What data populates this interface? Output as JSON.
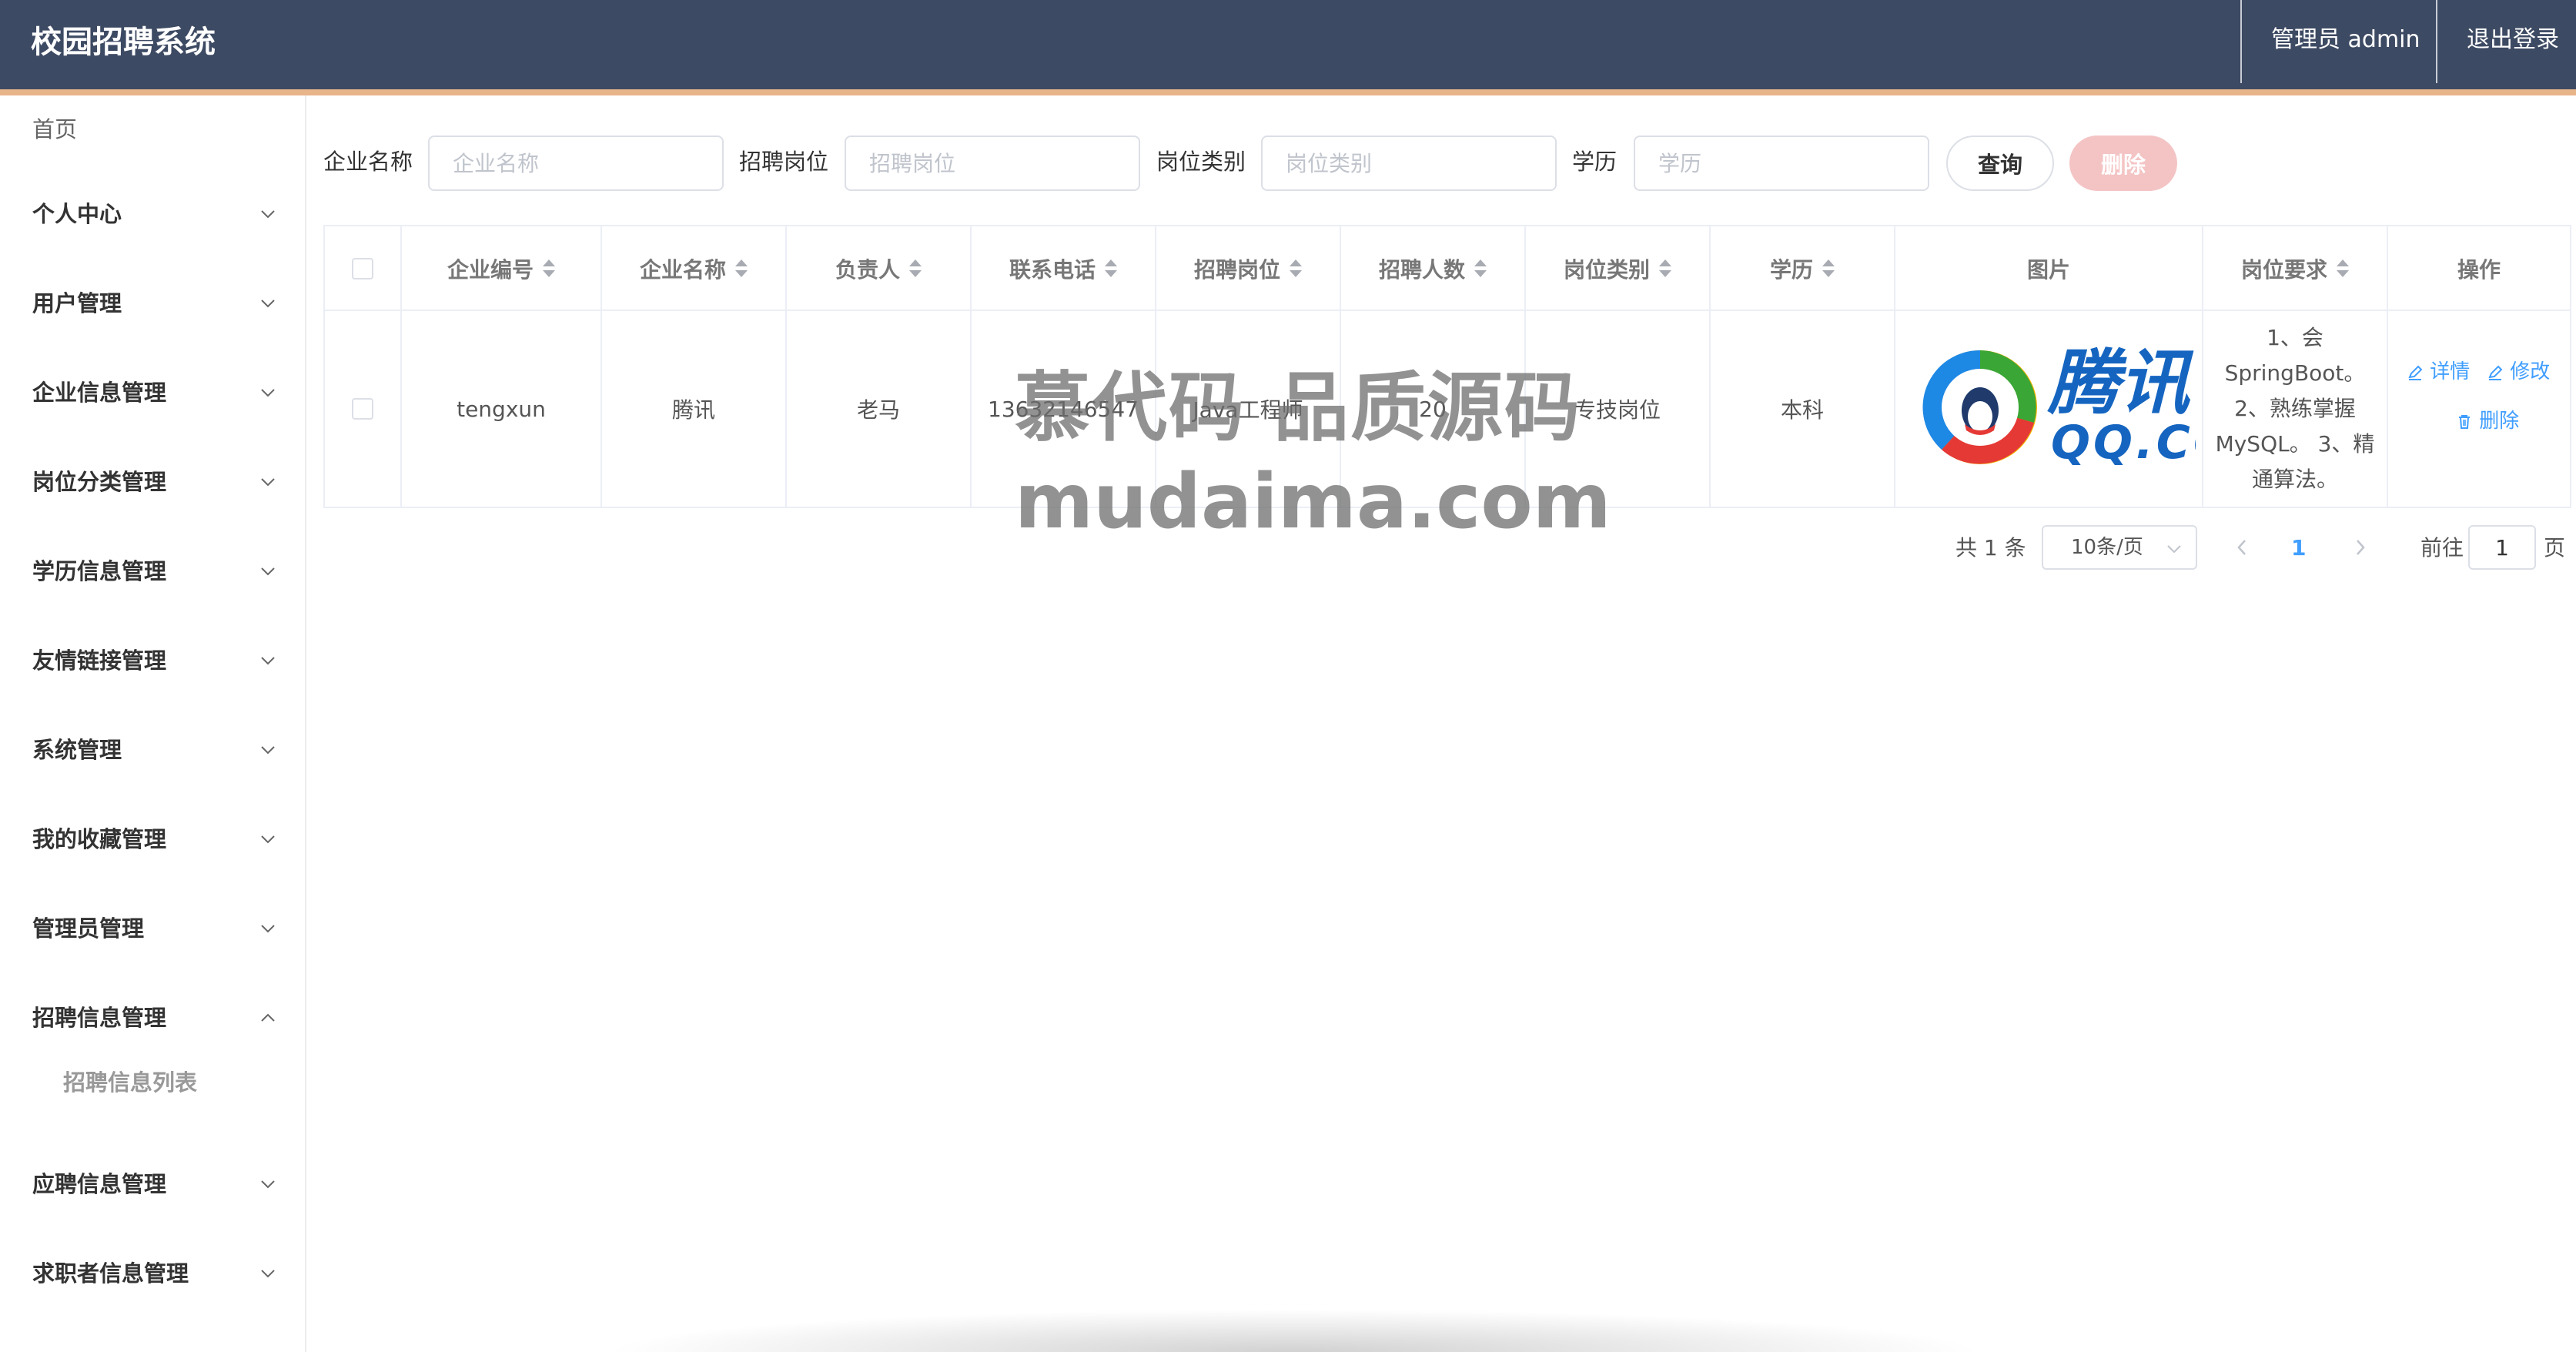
{
  "header": {
    "title": "校园招聘系统",
    "user": "管理员 admin",
    "logout": "退出登录"
  },
  "sidebar": {
    "home": "首页",
    "items": [
      {
        "label": "个人中心",
        "expanded": false
      },
      {
        "label": "用户管理",
        "expanded": false
      },
      {
        "label": "企业信息管理",
        "expanded": false
      },
      {
        "label": "岗位分类管理",
        "expanded": false
      },
      {
        "label": "学历信息管理",
        "expanded": false
      },
      {
        "label": "友情链接管理",
        "expanded": false
      },
      {
        "label": "系统管理",
        "expanded": false
      },
      {
        "label": "我的收藏管理",
        "expanded": false
      },
      {
        "label": "管理员管理",
        "expanded": false
      },
      {
        "label": "招聘信息管理",
        "expanded": true
      },
      {
        "label": "应聘信息管理",
        "expanded": false
      },
      {
        "label": "求职者信息管理",
        "expanded": false
      }
    ],
    "subitem": "招聘信息列表"
  },
  "search": {
    "company_label": "企业名称",
    "company_placeholder": "企业名称",
    "position_label": "招聘岗位",
    "position_placeholder": "招聘岗位",
    "category_label": "岗位类别",
    "category_placeholder": "岗位类别",
    "education_label": "学历",
    "education_placeholder": "学历",
    "query_button": "查询",
    "delete_button": "删除"
  },
  "table": {
    "headers": [
      "企业编号",
      "企业名称",
      "负责人",
      "联系电话",
      "招聘岗位",
      "招聘人数",
      "岗位类别",
      "学历",
      "图片",
      "岗位要求",
      "操作"
    ],
    "rows": [
      {
        "company_id": "tengxun",
        "company_name": "腾讯",
        "manager": "老马",
        "phone": "13632146547",
        "position": "Java工程师",
        "count": "20",
        "category": "专技岗位",
        "education": "本科",
        "image_text": "腾讯",
        "image_subtext": "QQ.CO",
        "requirement": "1、会SpringBoot。 2、熟练掌握MySQL。 3、精通算法。",
        "actions": {
          "detail": "详情",
          "edit": "修改",
          "delete": "删除"
        }
      }
    ]
  },
  "pagination": {
    "total": "共 1 条",
    "page_size": "10条/页",
    "current_page": "1",
    "goto_label": "前往",
    "goto_value": "1",
    "page_suffix": "页"
  },
  "watermark": {
    "line1": "慕代码 品质源码",
    "line2": "mudaima.com"
  },
  "colors": {
    "header_bg": "#3d4a63",
    "header_accent": "#e8b489",
    "link": "#409eff",
    "delete_button": "#f4c4c4"
  }
}
